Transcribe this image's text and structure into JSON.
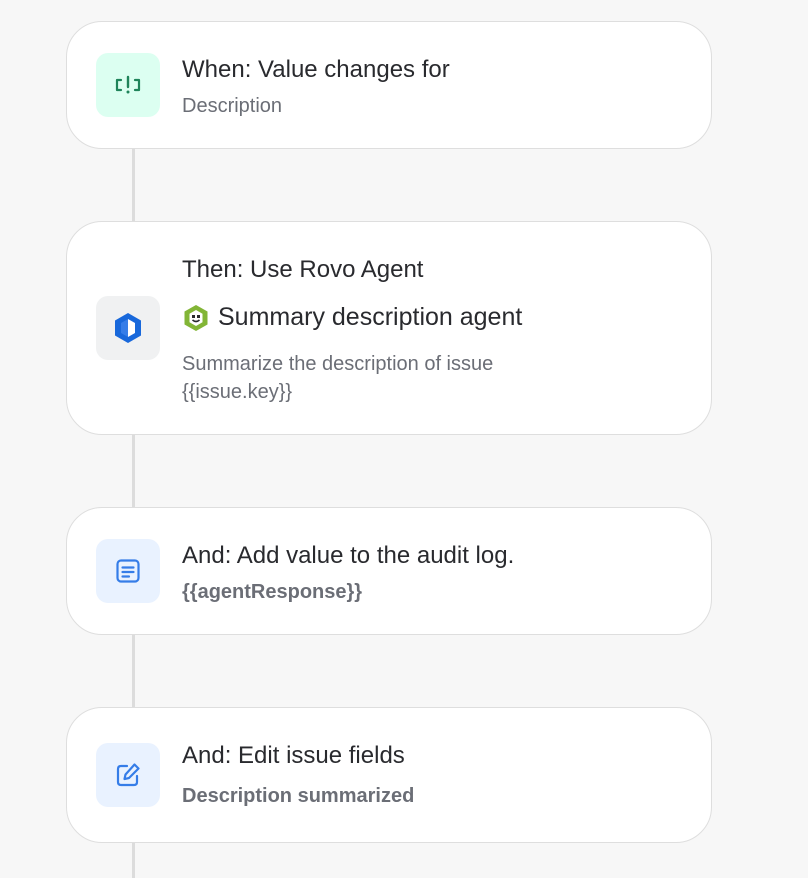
{
  "steps": [
    {
      "title": "When: Value changes for",
      "subtitle": "Description",
      "icon": "value-change-icon"
    },
    {
      "title": "Then: Use Rovo Agent",
      "agent_name": "Summary description agent",
      "agent_icon": "agent-avatar-icon",
      "prompt_line1": "Summarize the description of issue",
      "prompt_line2": "{{issue.key}}",
      "icon": "rovo-icon"
    },
    {
      "title": "And: Add value to the audit log.",
      "subtitle": "{{agentResponse}}",
      "icon": "audit-log-icon"
    },
    {
      "title": "And: Edit issue fields",
      "subtitle": "Description summarized",
      "icon": "edit-icon"
    }
  ],
  "colors": {
    "trigger_bg": "#dcfff1",
    "trigger_fg": "#1f845a",
    "rovo_bg": "#f0f1f2",
    "rovo_fg": "#1868db",
    "action_bg": "#e9f2ff",
    "action_fg": "#357de8",
    "agent_green": "#82b536"
  }
}
